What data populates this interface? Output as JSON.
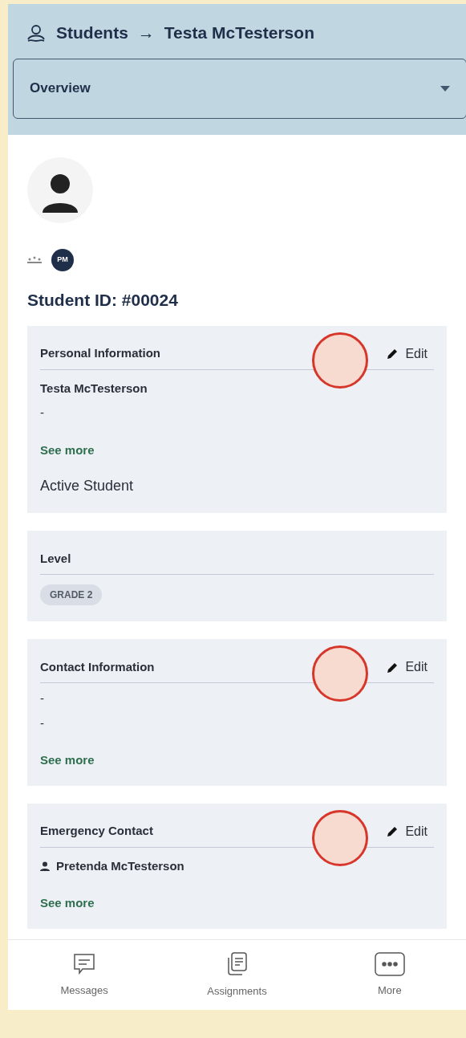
{
  "header": {
    "breadcrumb": [
      "Students",
      "Testa McTesterson"
    ],
    "separator": "→",
    "dropdown": {
      "value": "Overview"
    }
  },
  "profile": {
    "badge": "PM",
    "student_id": "Student ID: #00024"
  },
  "sections": [
    {
      "title": "Personal Information",
      "edit": "Edit",
      "tap_marker": true,
      "items": [
        {
          "kind": "name",
          "text": "Testa McTesterson"
        },
        {
          "kind": "text",
          "text": "-"
        },
        {
          "kind": "link",
          "text": "See more"
        },
        {
          "kind": "status",
          "text": "Active Student"
        }
      ]
    },
    {
      "title": "Level",
      "tap_marker": false,
      "items": [
        {
          "kind": "tag",
          "text": "GRADE 2"
        }
      ]
    },
    {
      "title": "Contact Information",
      "edit": "Edit",
      "tap_marker": true,
      "items": [
        {
          "kind": "text",
          "text": "-"
        },
        {
          "kind": "text",
          "text": "-"
        },
        {
          "kind": "link",
          "text": "See more"
        }
      ]
    },
    {
      "title": "Emergency Contact",
      "edit": "Edit",
      "tap_marker": true,
      "items": [
        {
          "kind": "person",
          "text": "Pretenda McTesterson"
        },
        {
          "kind": "link",
          "text": "See more"
        }
      ]
    }
  ],
  "nav": [
    {
      "kind": "messages",
      "label": "Messages"
    },
    {
      "kind": "assignments",
      "label": "Assignments"
    },
    {
      "kind": "more",
      "label": "More"
    }
  ]
}
